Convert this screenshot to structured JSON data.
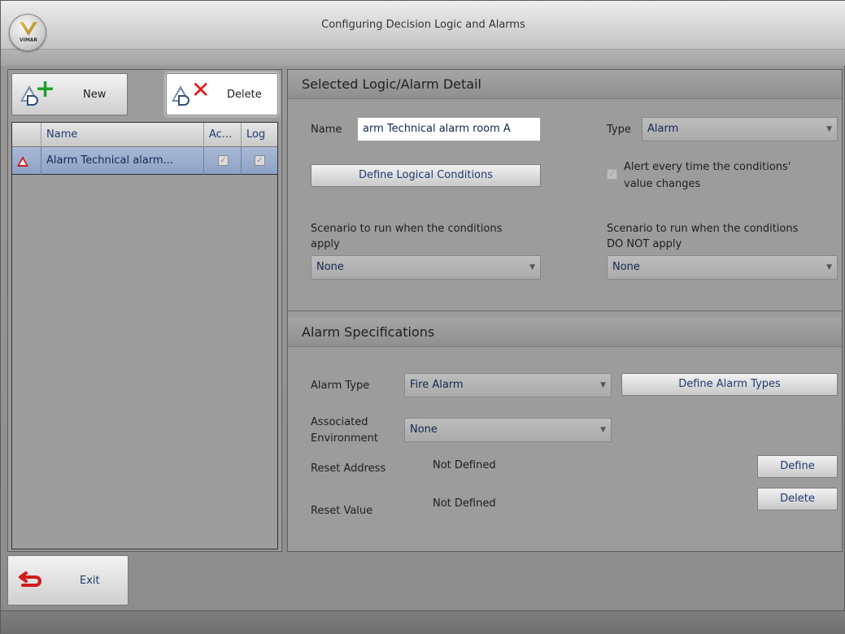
{
  "window": {
    "title": "Configuring Decision Logic and Alarms",
    "logo_text": "VIMAR"
  },
  "toolbar": {
    "new_label": "New",
    "delete_label": "Delete"
  },
  "grid": {
    "columns": [
      "Name",
      "Ac...",
      "Log"
    ],
    "rows": [
      {
        "name": "Alarm Technical alarm...",
        "active": true,
        "log": true
      }
    ]
  },
  "detail": {
    "header": "Selected Logic/Alarm Detail",
    "name_label": "Name",
    "name_value": "arm Technical alarm room A",
    "type_label": "Type",
    "type_value": "Alarm",
    "define_conditions_label": "Define Logical Conditions",
    "alert_line1": "Alert every time the conditions'",
    "alert_line2": "value changes",
    "scenario_apply_line1": "Scenario to run when the conditions",
    "scenario_apply_line2": "apply",
    "scenario_apply_value": "None",
    "scenario_not_apply_line1": "Scenario to run when the conditions",
    "scenario_not_apply_line2": "DO NOT apply",
    "scenario_not_apply_value": "None"
  },
  "alarm": {
    "header": "Alarm Specifications",
    "type_label": "Alarm Type",
    "type_value": "Fire Alarm",
    "define_types_label": "Define Alarm Types",
    "env_label_line1": "Associated",
    "env_label_line2": "Environment",
    "env_value": "None",
    "reset_address_label": "Reset Address",
    "reset_address_value": "Not Defined",
    "define_label": "Define",
    "reset_value_label": "Reset Value",
    "reset_value_value": "Not Defined",
    "delete_label": "Delete"
  },
  "footer": {
    "exit_label": "Exit"
  },
  "colors": {
    "accent_text": "#1f3b70",
    "selected_row": "#9db0d0",
    "delete_red": "#e01c1c",
    "add_green": "#1fa02a"
  }
}
